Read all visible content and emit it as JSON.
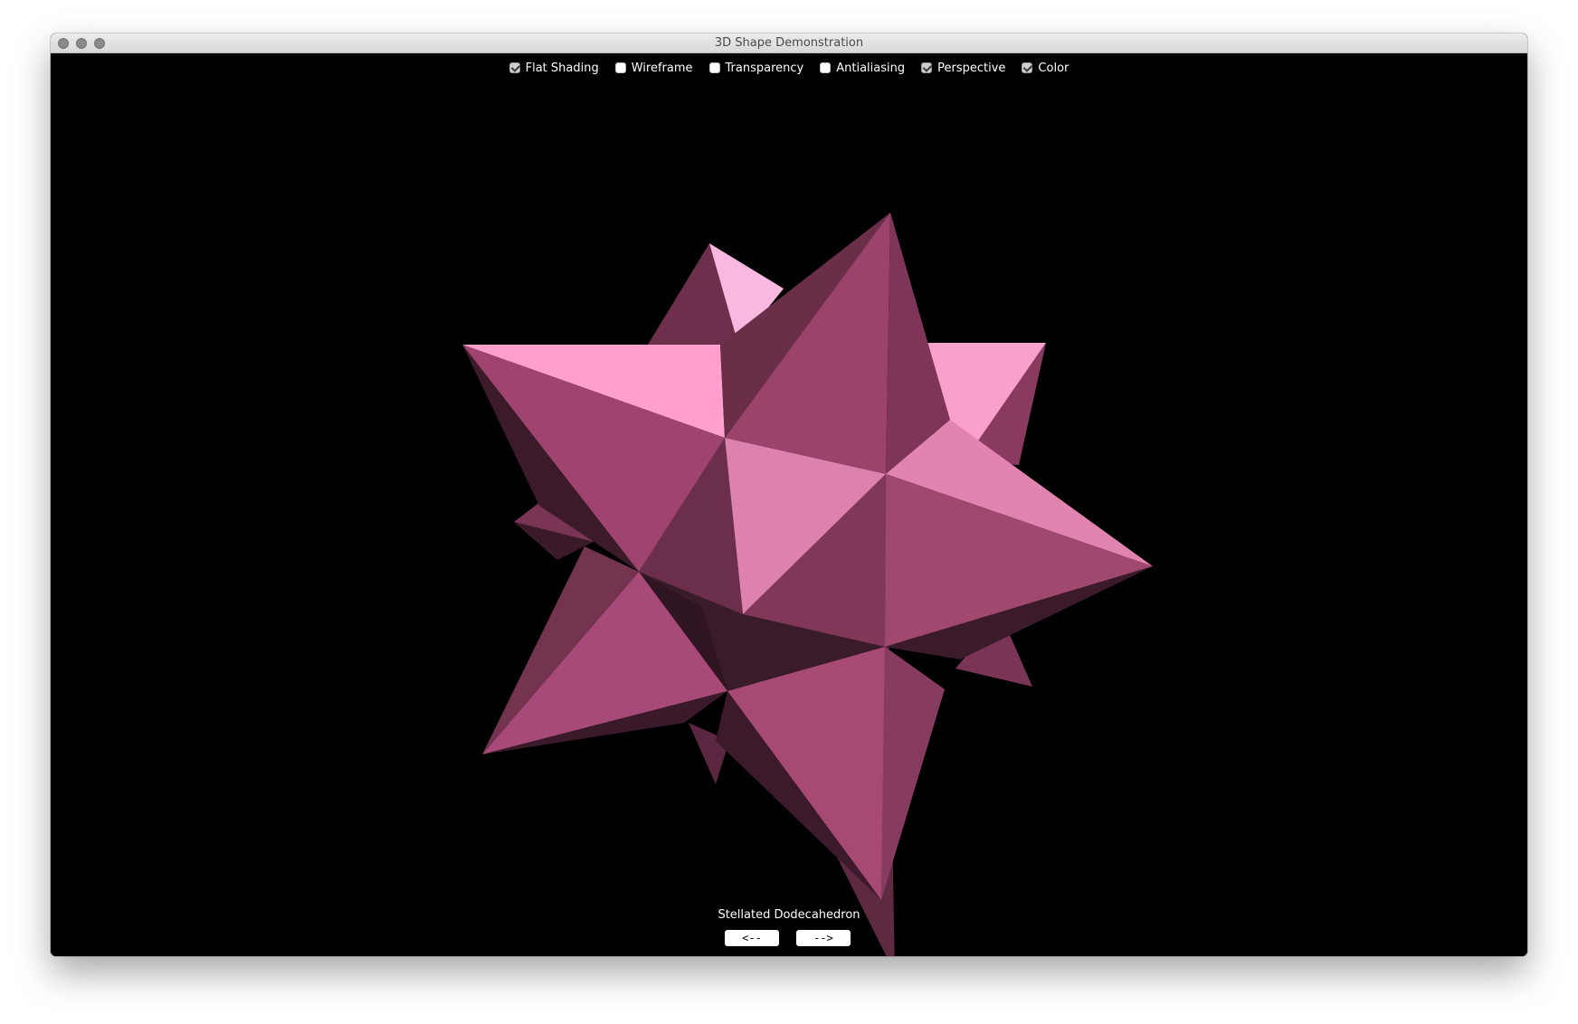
{
  "window": {
    "title": "3D Shape Demonstration"
  },
  "options": [
    {
      "label": "Flat Shading",
      "checked": true
    },
    {
      "label": "Wireframe",
      "checked": false
    },
    {
      "label": "Transparency",
      "checked": false
    },
    {
      "label": "Antialiasing",
      "checked": false
    },
    {
      "label": "Perspective",
      "checked": true
    },
    {
      "label": "Color",
      "checked": true
    }
  ],
  "viewer": {
    "shape_name": "Stellated Dodecahedron",
    "shape_color": "#d4789f",
    "background_color": "#000000"
  },
  "navigation": {
    "prev_label": "<--",
    "next_label": "-->"
  }
}
